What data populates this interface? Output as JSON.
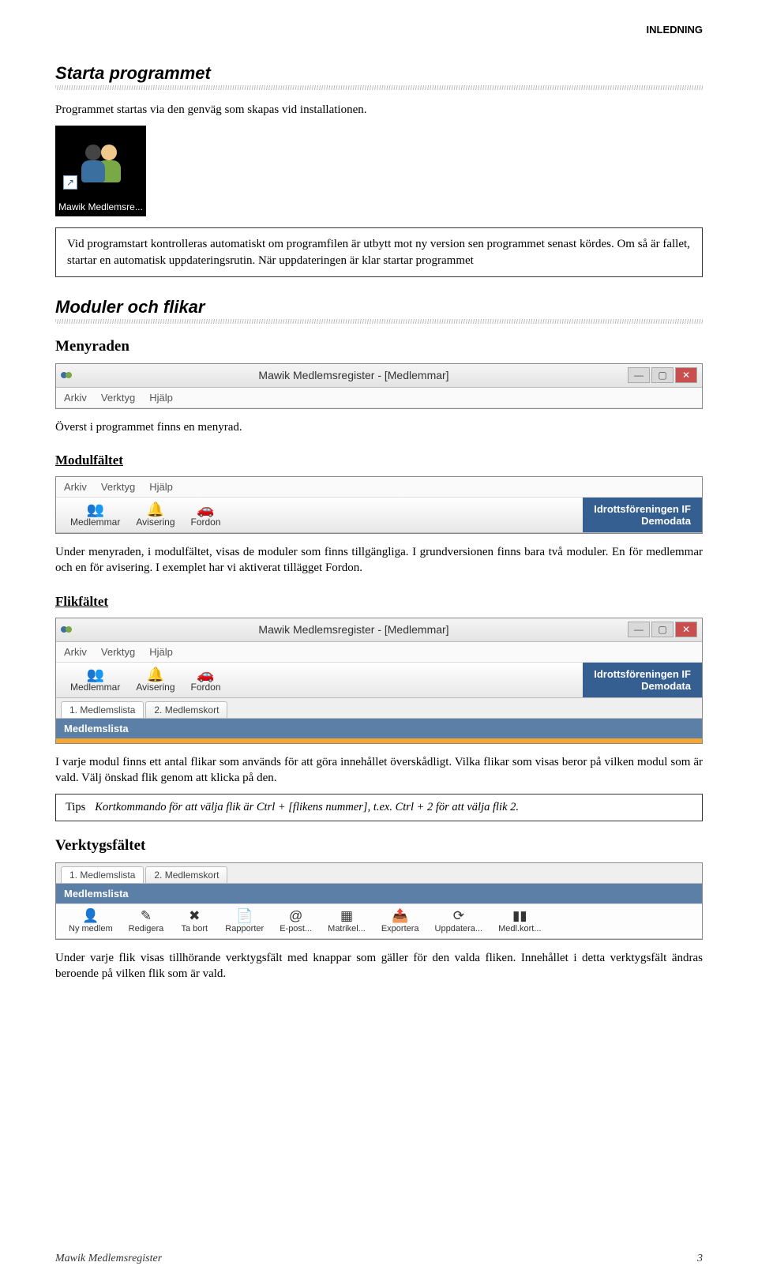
{
  "header": {
    "label": "INLEDNING"
  },
  "section1": {
    "title": "Starta programmet",
    "intro": "Programmet startas via den genväg som skapas vid installationen.",
    "shortcut_label": "Mawik Medlemsre...",
    "box_text": "Vid programstart kontrolleras automatiskt om programfilen är utbytt mot ny version sen programmet senast kördes. Om så är fallet, startar en automatisk uppdateringsrutin. När uppdateringen är klar startar programmet"
  },
  "section2": {
    "title": "Moduler och flikar",
    "menyraden": {
      "heading": "Menyraden",
      "window_title": "Mawik Medlemsregister - [Medlemmar]",
      "menus": [
        "Arkiv",
        "Verktyg",
        "Hjälp"
      ],
      "caption": "Överst i programmet finns en menyrad."
    },
    "modulfaltet": {
      "heading": "Modulfältet",
      "menus": [
        "Arkiv",
        "Verktyg",
        "Hjälp"
      ],
      "modules": [
        {
          "icon": "👥",
          "label": "Medlemmar"
        },
        {
          "icon": "🔔",
          "label": "Avisering"
        },
        {
          "icon": "🚗",
          "label": "Fordon"
        }
      ],
      "orgname_line1": "Idrottsföreningen IF",
      "orgname_line2": "Demodata",
      "caption": "Under menyraden, i modulfältet, visas de moduler som finns tillgängliga. I grundversionen finns bara två moduler. En för medlemmar och en för avisering. I exemplet har vi aktiverat tillägget Fordon."
    },
    "flikfaltet": {
      "heading": "Flikfältet",
      "window_title": "Mawik Medlemsregister - [Medlemmar]",
      "menus": [
        "Arkiv",
        "Verktyg",
        "Hjälp"
      ],
      "modules": [
        {
          "icon": "👥",
          "label": "Medlemmar"
        },
        {
          "icon": "🔔",
          "label": "Avisering"
        },
        {
          "icon": "🚗",
          "label": "Fordon"
        }
      ],
      "orgname_line1": "Idrottsföreningen IF",
      "orgname_line2": "Demodata",
      "tabs": [
        "1. Medlemslista",
        "2. Medlemskort"
      ],
      "active_tab_title": "Medlemslista",
      "caption": "I varje modul finns ett antal flikar som används för att göra innehållet överskådligt. Vilka flikar som visas beror på vilken modul som är vald. Välj önskad flik genom att klicka på den.",
      "tips_label": "Tips",
      "tips_text": "Kortkommando för att välja flik är Ctrl + [flikens nummer], t.ex. Ctrl + 2 för att välja flik 2."
    },
    "verktygsfaltet": {
      "heading": "Verktygsfältet",
      "tabs": [
        "1. Medlemslista",
        "2. Medlemskort"
      ],
      "active_tab_title": "Medlemslista",
      "tools": [
        {
          "icon": "👤",
          "label": "Ny medlem"
        },
        {
          "icon": "✎",
          "label": "Redigera"
        },
        {
          "icon": "✖",
          "label": "Ta bort"
        },
        {
          "icon": "📄",
          "label": "Rapporter"
        },
        {
          "icon": "@",
          "label": "E-post..."
        },
        {
          "icon": "▦",
          "label": "Matrikel..."
        },
        {
          "icon": "📤",
          "label": "Exportera"
        },
        {
          "icon": "⟳",
          "label": "Uppdatera..."
        },
        {
          "icon": "▮▮",
          "label": "Medl.kort..."
        }
      ],
      "caption": "Under varje flik visas tillhörande verktygsfält med knappar som gäller för den valda fliken. Innehållet i detta verktygsfält ändras beroende på vilken flik som är vald."
    }
  },
  "footer": {
    "left": "Mawik Medlemsregister",
    "right": "3"
  }
}
